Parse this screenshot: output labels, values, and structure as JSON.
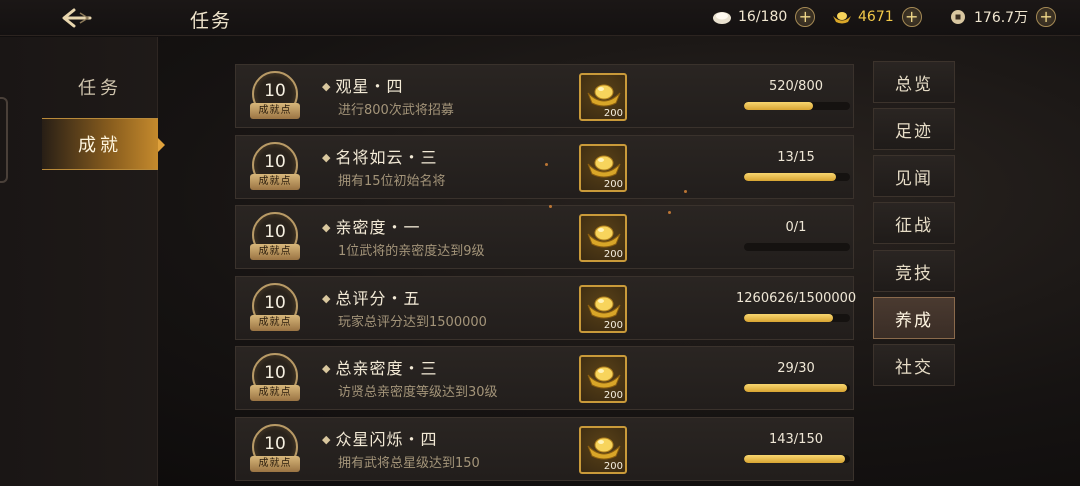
{
  "header": {
    "title": "任务",
    "currencies": [
      {
        "icon": "silver-ingot-icon",
        "value": "16/180"
      },
      {
        "icon": "gold-ingot-icon",
        "value": "4671"
      },
      {
        "icon": "copper-coin-icon",
        "value": "176.7万"
      }
    ]
  },
  "left_tabs": [
    {
      "label": "任务",
      "active": false
    },
    {
      "label": "成就",
      "active": true
    }
  ],
  "badge_label": "成就点",
  "achievements": [
    {
      "points": "10",
      "title": "观星・四",
      "desc": "进行800次武将招募",
      "reward_count": "200",
      "progress": "520/800",
      "ratio": 0.65
    },
    {
      "points": "10",
      "title": "名将如云・三",
      "desc": "拥有15位初始名将",
      "reward_count": "200",
      "progress": "13/15",
      "ratio": 0.867
    },
    {
      "points": "10",
      "title": "亲密度・一",
      "desc": "1位武将的亲密度达到9级",
      "reward_count": "200",
      "progress": "0/1",
      "ratio": 0
    },
    {
      "points": "10",
      "title": "总评分・五",
      "desc": "玩家总评分达到1500000",
      "reward_count": "200",
      "progress": "1260626/1500000",
      "ratio": 0.84
    },
    {
      "points": "10",
      "title": "总亲密度・三",
      "desc": "访贤总亲密度等级达到30级",
      "reward_count": "200",
      "progress": "29/30",
      "ratio": 0.967
    },
    {
      "points": "10",
      "title": "众星闪烁・四",
      "desc": "拥有武将总星级达到150",
      "reward_count": "200",
      "progress": "143/150",
      "ratio": 0.953
    }
  ],
  "categories": [
    {
      "label": "总览",
      "active": false
    },
    {
      "label": "足迹",
      "active": false
    },
    {
      "label": "见闻",
      "active": false
    },
    {
      "label": "征战",
      "active": false
    },
    {
      "label": "竞技",
      "active": false
    },
    {
      "label": "养成",
      "active": true
    },
    {
      "label": "社交",
      "active": false
    }
  ],
  "colors": {
    "accent_gold": "#f2c949",
    "active_tab": "#c58a2d"
  }
}
